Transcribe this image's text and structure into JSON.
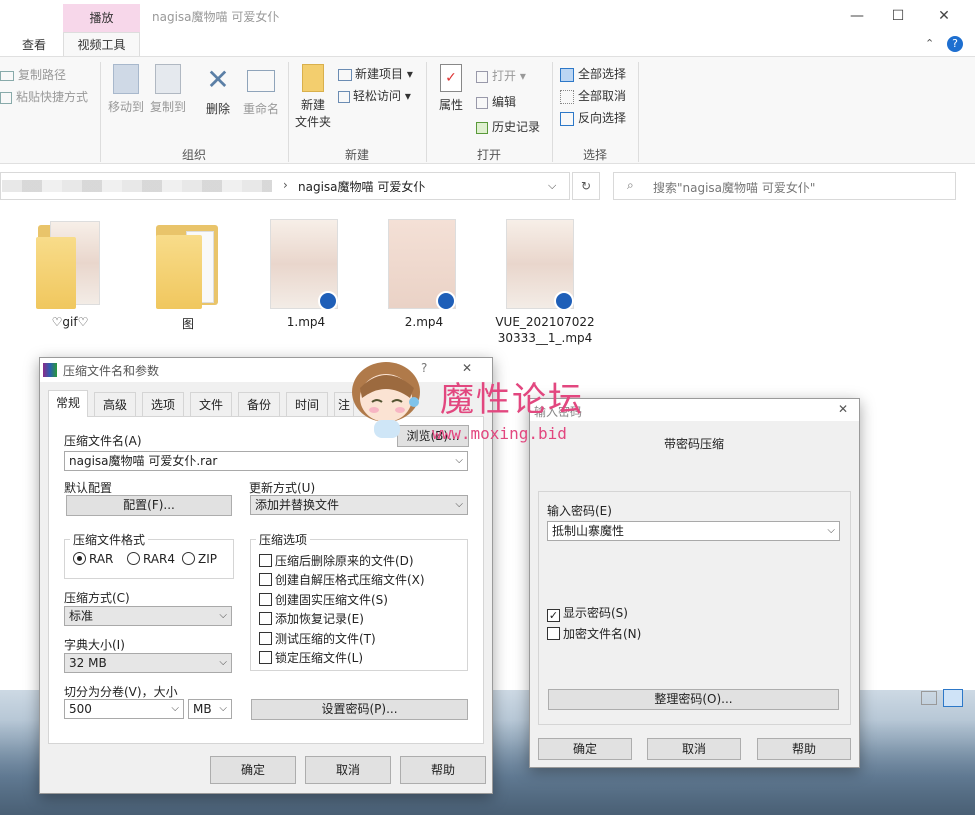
{
  "explorer": {
    "context_tab": "播放",
    "window_title": "nagisa魔物喵 可爱女仆",
    "tabs": {
      "view": "查看",
      "video_tools": "视频工具"
    },
    "window_buttons": {
      "minimize": "—",
      "maximize": "☐",
      "close": "✕"
    },
    "ribbon": {
      "clipboard": {
        "copy_path": "复制路径",
        "paste_shortcut": "粘贴快捷方式"
      },
      "organize": {
        "label": "组织",
        "move_to": "移动到",
        "copy_to": "复制到",
        "delete": "删除",
        "rename": "重命名"
      },
      "new": {
        "label": "新建",
        "new_folder_line1": "新建",
        "new_folder_line2": "文件夹",
        "new_item": "新建项目 ▾",
        "easy_access": "轻松访问 ▾"
      },
      "open": {
        "label": "打开",
        "properties": "属性",
        "open": "打开 ▾",
        "edit": "编辑",
        "history": "历史记录"
      },
      "select": {
        "label": "选择",
        "select_all": "全部选择",
        "select_none": "全部取消",
        "invert": "反向选择"
      }
    },
    "address": {
      "path": "nagisa魔物喵 可爱女仆",
      "chevron": "›",
      "refresh": "↻"
    },
    "search": {
      "placeholder": "搜索\"nagisa魔物喵 可爱女仆\""
    },
    "files": [
      {
        "name": "♡gif♡",
        "type": "folder"
      },
      {
        "name": "图",
        "type": "folder"
      },
      {
        "name": "1.mp4",
        "type": "video"
      },
      {
        "name": "2.mp4",
        "type": "video"
      },
      {
        "name_line1": "VUE_202107022",
        "name_line2": "30333__1_.mp4",
        "type": "video"
      }
    ]
  },
  "watermark": {
    "title": "魔性论坛",
    "url": "www.moxing.bid"
  },
  "compress_dialog": {
    "title": "压缩文件名和参数",
    "help_btn": "?",
    "close_btn": "✕",
    "tabs": [
      "常规",
      "高级",
      "选项",
      "文件",
      "备份",
      "时间",
      "注"
    ],
    "archive_name_label": "压缩文件名(A)",
    "browse": "浏览(B)...",
    "archive_name": "nagisa魔物喵 可爱女仆.rar",
    "default_profile_label": "默认配置",
    "profile_btn": "配置(F)...",
    "update_mode_label": "更新方式(U)",
    "update_mode": "添加并替换文件",
    "format_group": "压缩文件格式",
    "formats": [
      "RAR",
      "RAR4",
      "ZIP"
    ],
    "selected_format": "RAR",
    "options_group": "压缩选项",
    "options": [
      "压缩后删除原来的文件(D)",
      "创建自解压格式压缩文件(X)",
      "创建固实压缩文件(S)",
      "添加恢复记录(E)",
      "测试压缩的文件(T)",
      "锁定压缩文件(L)"
    ],
    "method_label": "压缩方式(C)",
    "method": "标准",
    "dict_label": "字典大小(I)",
    "dict": "32 MB",
    "split_label": "切分为分卷(V)，大小",
    "split_value": "500",
    "split_unit": "MB",
    "set_password": "设置密码(P)...",
    "ok": "确定",
    "cancel": "取消",
    "help": "帮助"
  },
  "password_dialog": {
    "title": "输入密码",
    "close_btn": "✕",
    "heading": "带密码压缩",
    "input_label": "输入密码(E)",
    "password_value": "抵制山寨魔性",
    "show_password": "显示密码(S)",
    "show_password_checked": true,
    "encrypt_names": "加密文件名(N)",
    "encrypt_names_checked": false,
    "organize": "整理密码(O)...",
    "ok": "确定",
    "cancel": "取消",
    "help": "帮助"
  }
}
